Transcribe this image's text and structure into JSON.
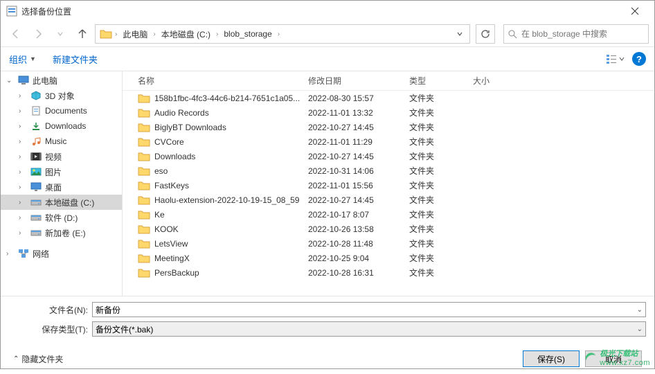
{
  "window": {
    "title": "选择备份位置"
  },
  "breadcrumb": {
    "items": [
      "此电脑",
      "本地磁盘 (C:)",
      "blob_storage"
    ]
  },
  "search": {
    "placeholder": "在 blob_storage 中搜索"
  },
  "toolbar": {
    "organize": "组织",
    "new_folder": "新建文件夹"
  },
  "sidebar": {
    "this_pc": "此电脑",
    "items": [
      {
        "label": "3D 对象",
        "icon": "3d"
      },
      {
        "label": "Documents",
        "icon": "doc"
      },
      {
        "label": "Downloads",
        "icon": "dl"
      },
      {
        "label": "Music",
        "icon": "music"
      },
      {
        "label": "视频",
        "icon": "video"
      },
      {
        "label": "图片",
        "icon": "pic"
      },
      {
        "label": "桌面",
        "icon": "desktop"
      },
      {
        "label": "本地磁盘 (C:)",
        "icon": "drive",
        "selected": true
      },
      {
        "label": "软件 (D:)",
        "icon": "drive"
      },
      {
        "label": "新加卷 (E:)",
        "icon": "drive"
      }
    ],
    "network": "网络"
  },
  "columns": {
    "name": "名称",
    "date": "修改日期",
    "type": "类型",
    "size": "大小"
  },
  "files": [
    {
      "name": "158b1fbc-4fc3-44c6-b214-7651c1a05...",
      "date": "2022-08-30 15:57",
      "type": "文件夹"
    },
    {
      "name": "Audio Records",
      "date": "2022-11-01 13:32",
      "type": "文件夹"
    },
    {
      "name": "BiglyBT Downloads",
      "date": "2022-10-27 14:45",
      "type": "文件夹"
    },
    {
      "name": "CVCore",
      "date": "2022-11-01 11:29",
      "type": "文件夹"
    },
    {
      "name": "Downloads",
      "date": "2022-10-27 14:45",
      "type": "文件夹"
    },
    {
      "name": "eso",
      "date": "2022-10-31 14:06",
      "type": "文件夹"
    },
    {
      "name": "FastKeys",
      "date": "2022-11-01 15:56",
      "type": "文件夹"
    },
    {
      "name": "Haolu-extension-2022-10-19-15_08_59",
      "date": "2022-10-27 14:45",
      "type": "文件夹"
    },
    {
      "name": "Ke",
      "date": "2022-10-17 8:07",
      "type": "文件夹"
    },
    {
      "name": "KOOK",
      "date": "2022-10-26 13:58",
      "type": "文件夹"
    },
    {
      "name": "LetsView",
      "date": "2022-10-28 11:48",
      "type": "文件夹"
    },
    {
      "name": "MeetingX",
      "date": "2022-10-25 9:04",
      "type": "文件夹"
    },
    {
      "name": "PersBackup",
      "date": "2022-10-28 16:31",
      "type": "文件夹"
    }
  ],
  "bottom": {
    "filename_label": "文件名(N):",
    "filename_value": "新备份",
    "filetype_label": "保存类型(T):",
    "filetype_value": "备份文件(*.bak)"
  },
  "footer": {
    "hide_folders": "隐藏文件夹",
    "save": "保存(S)",
    "cancel": "取消"
  },
  "watermark": {
    "text": "极光下载站",
    "site": "www.xz7.com"
  }
}
